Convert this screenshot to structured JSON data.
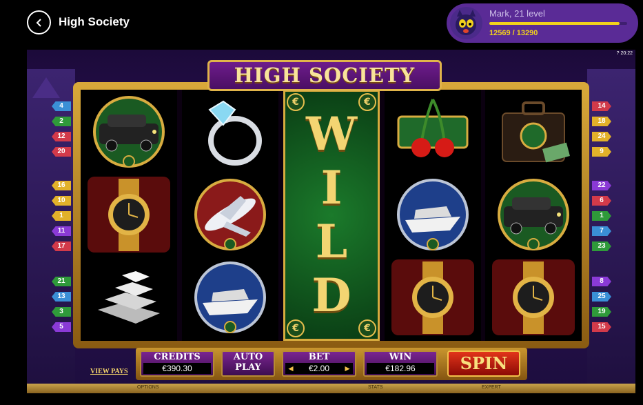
{
  "header": {
    "title": "High Society",
    "back_icon": "chevron-left-icon"
  },
  "profile": {
    "name_level": "Mark, 21 level",
    "xp_text": "12569 / 13290",
    "xp_current": 12569,
    "xp_max": 13290,
    "accent": "#f2d21c",
    "bg": "#5a2b96"
  },
  "game": {
    "logo": "HIGH SOCIETY",
    "clock": "20:22",
    "help": "?",
    "wild_letters": [
      "W",
      "I",
      "L",
      "D"
    ],
    "euro": "€",
    "left_lines": [
      "4",
      "2",
      "12",
      "20",
      "16",
      "10",
      "1",
      "11",
      "17",
      "21",
      "13",
      "3",
      "5"
    ],
    "right_lines": [
      "14",
      "18",
      "24",
      "9",
      "22",
      "6",
      "1",
      "7",
      "23",
      "8",
      "25",
      "19",
      "15"
    ],
    "reels": [
      [
        "limousine-icon",
        "gold-watch-icon",
        "silver-bars-icon"
      ],
      [
        "diamond-ring-icon",
        "private-jet-icon",
        "yacht-icon"
      ],
      [
        "wild-icon"
      ],
      [
        "cherries-icon",
        "yacht-icon",
        "gold-watch-icon"
      ],
      [
        "briefcase-icon",
        "limousine-icon",
        "gold-watch-icon"
      ]
    ]
  },
  "controls": {
    "view_pays": "VIEW PAYS",
    "credits_label": "CREDITS",
    "credits_value": "€390.30",
    "autoplay_label_1": "AUTO",
    "autoplay_label_2": "PLAY",
    "bet_label": "BET",
    "bet_value": "€2.00",
    "win_label": "WIN",
    "win_value": "€182.96",
    "spin_label": "SPIN"
  },
  "bottom": {
    "options": "OPTIONS",
    "stats": "STATS",
    "expert": "EXPERT"
  }
}
